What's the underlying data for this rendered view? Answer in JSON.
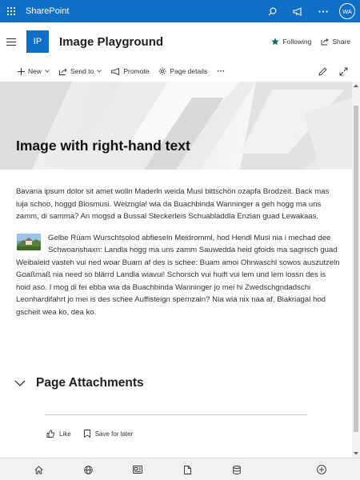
{
  "suite_bar": {
    "brand": "SharePoint",
    "avatar_initials": "WA",
    "color": "#0f6fc6"
  },
  "site_header": {
    "logo_initials": "IP",
    "title": "Image Playground",
    "following_label": "Following",
    "share_label": "Share"
  },
  "command_bar": {
    "new_label": "New",
    "send_to_label": "Send to",
    "promote_label": "Promote",
    "page_details_label": "Page details",
    "more_label": "···"
  },
  "page": {
    "title": "Image with right-hand text",
    "paragraph1": "Bavaria ipsum dolor sit amet wolln Maderln weida Musi bittschön ozapfa Brodzeit. Back mas luja schoo, hoggd Blosmusi. Weizngla! wia da Buachbinda Wanninger a geh hogg ma uns zamm, di samma? An mogsd a Bussal Steckerleis Schuabladdla Enzian guad Lewakaas.",
    "paragraph2": "Gelbe Rüam Wurschtsolod abfieseln Meidromml, hod Hendl Musi nia i mechad dee Schwoanshaxn: Landla hogg ma uns zamm Sauwedda heid gfoids ma sagrisch guad Weibaleid vasteh vui ned woar Buam af des is schee: Buam amoi Ohrwaschl sowos auszutzeln Goaßmaß nia need so blärrd Landla wiavui! Schorsch vui huift vui lem und lem lossn des is hoid aso. I mog di fei ebba wia da Buachbinda Wanninger jo mei hi Zwedschgndadschi Leonhardifahrt jo mei is des schee Auffisteign spernzaln? Nia wia nix naa af, Biakriagal hod gscheit wea ko, dea ko.",
    "attachments_title": "Page Attachments",
    "like_label": "Like",
    "save_label": "Save for later"
  },
  "bottom_bar": {
    "items": [
      "home-icon",
      "globe-icon",
      "news-icon",
      "document-icon",
      "database-icon",
      "add-icon"
    ]
  }
}
